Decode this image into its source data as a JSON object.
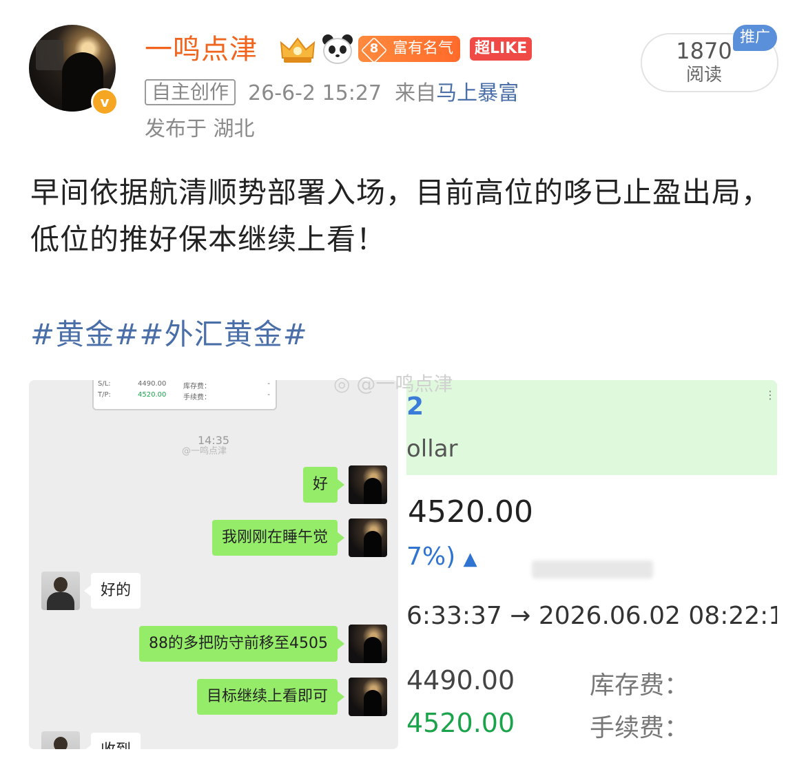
{
  "post": {
    "username": "一鸣点津",
    "fame_level": "8",
    "fame_badge": "富有名气",
    "like_badge": "超LIKE",
    "origin_tag": "自主创作",
    "time": "26-6-2 15:27",
    "source_prefix": "来自",
    "source_link": "马上暴富",
    "location": "发布于 湖北",
    "read_count": "1870",
    "read_label": "阅读",
    "promo_label": "推广",
    "text": "早间依据航清顺势部署入场，目前高位的哆已止盈出局，低位的推好保本继续上看！",
    "hashtags": "#黄金##外汇黄金#",
    "watermark": "@一鸣点津"
  },
  "chat": {
    "order_card": {
      "sl_label": "S/L:",
      "sl": "4490.00",
      "tp_label": "T/P:",
      "tp": "4520.00",
      "swap_label": "库存费：",
      "fee_label": "手续费：",
      "dash": "-"
    },
    "timestamp": "14:35",
    "watermark": "@一鸣点津",
    "messages": [
      {
        "from": "me",
        "text": "好"
      },
      {
        "from": "me",
        "text": "我刚刚在睡午觉"
      },
      {
        "from": "them",
        "text": "好的"
      },
      {
        "from": "me",
        "text": "88的多把防守前移至4505"
      },
      {
        "from": "me",
        "text": "目标继续上看即可"
      },
      {
        "from": "them",
        "text": "收到"
      }
    ]
  },
  "order": {
    "code_partial": "2",
    "currency_partial": "ollar",
    "price": "4520.00",
    "change_partial": "7%)",
    "time_range": "6:33:37 → 2026.06.02 08:22:1",
    "sl": "4490.00",
    "tp": "4520.00",
    "swap_label": "库存费：",
    "fee_label": "手续费：",
    "colors": {
      "tp_green": "#1aa34a",
      "band": "#dff9dc",
      "link_blue": "#4a6ea8",
      "username_orange": "#f0641e"
    }
  }
}
